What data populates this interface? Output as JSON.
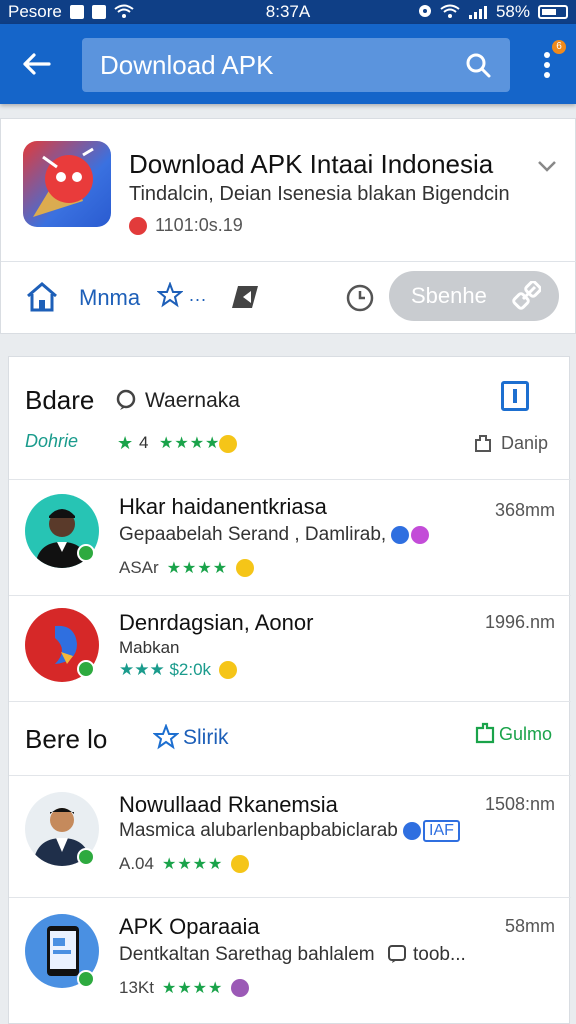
{
  "status_bar": {
    "carrier": "Pesore",
    "time": "8:37A",
    "battery": "58%"
  },
  "app_bar": {
    "search_query": "Download APK",
    "notification_count": "6"
  },
  "featured": {
    "title": "Download APK Intaai Indonesia",
    "subtitle": "Tindalcin, Deian Isenesia blakan Bigendcin",
    "meta": "1101:0s.19",
    "action_label": "Mnma",
    "action_dots": "...",
    "share_label": "Sbenhe"
  },
  "section1": {
    "title": "Bdare",
    "filter_label": "Waernaka",
    "tag": "Dohrie",
    "rating_text": "4",
    "stars": "★★★★",
    "right_label": "Danip"
  },
  "section2": {
    "title": "Bere  lo",
    "star_label": "Slirik",
    "right_label": "Gulmo"
  },
  "apps": [
    {
      "name": "Hkar haidanentkriasa",
      "desc": "Gepaabelah Serand , Damlirab,",
      "meta": "ASAr",
      "stars": "★★★★",
      "size": "368mm"
    },
    {
      "name": "Denrdagsian, Aonor",
      "desc": "Mabkan",
      "meta": "★★★ $2:0k",
      "stars": "",
      "size": "1996.nm"
    },
    {
      "name": "Nowullaad Rkanemsia",
      "desc": "Masmica alubarlenbapbabiclarab",
      "tag": "IAF",
      "meta": "A.04",
      "stars": "★★★★",
      "size": "1508:nm"
    },
    {
      "name": "APK Oparaaia",
      "desc": "Dentkaltan Sarethag bahlalem",
      "desc_extra": "toob...",
      "meta": "13Kt",
      "stars": "★★★★",
      "size": "58mm"
    }
  ],
  "colors": {
    "primary": "#1565c9",
    "status_bar": "#0f3f86",
    "rating_green": "#1aa34a",
    "accent_teal": "#1a9b8c"
  }
}
